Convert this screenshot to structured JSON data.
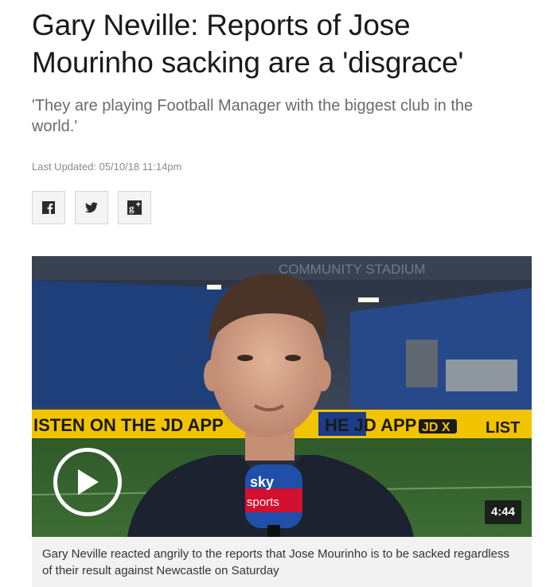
{
  "article": {
    "headline": "Gary Neville: Reports of Jose Mourinho sacking are a 'disgrace'",
    "standfirst": "'They are playing Football Manager with the biggest club in the world.'",
    "last_updated": "Last Updated: 05/10/18 11:14pm"
  },
  "share": {
    "buttons": [
      {
        "icon": "facebook-icon"
      },
      {
        "icon": "twitter-icon"
      },
      {
        "icon": "google-plus-icon"
      }
    ]
  },
  "video": {
    "duration": "4:44",
    "caption": "Gary Neville reacted angrily to the reports that Jose Mourinho is to be sacked regardless of their result against Newcastle on Saturday",
    "scene_text": {
      "stadium": "COMMUNITY STADIUM",
      "board_left": "ISTEN ON THE JD APP",
      "board_mid": "HE JD APP",
      "board_jd": "JD X",
      "board_right": "LIST",
      "mic_top": "sky",
      "mic_bottom": "sports"
    }
  },
  "colors": {
    "text": "#1a1a1a",
    "muted": "#6b6b6b",
    "caption_bg": "#f2f2f2",
    "board_yellow": "#f2c400"
  }
}
